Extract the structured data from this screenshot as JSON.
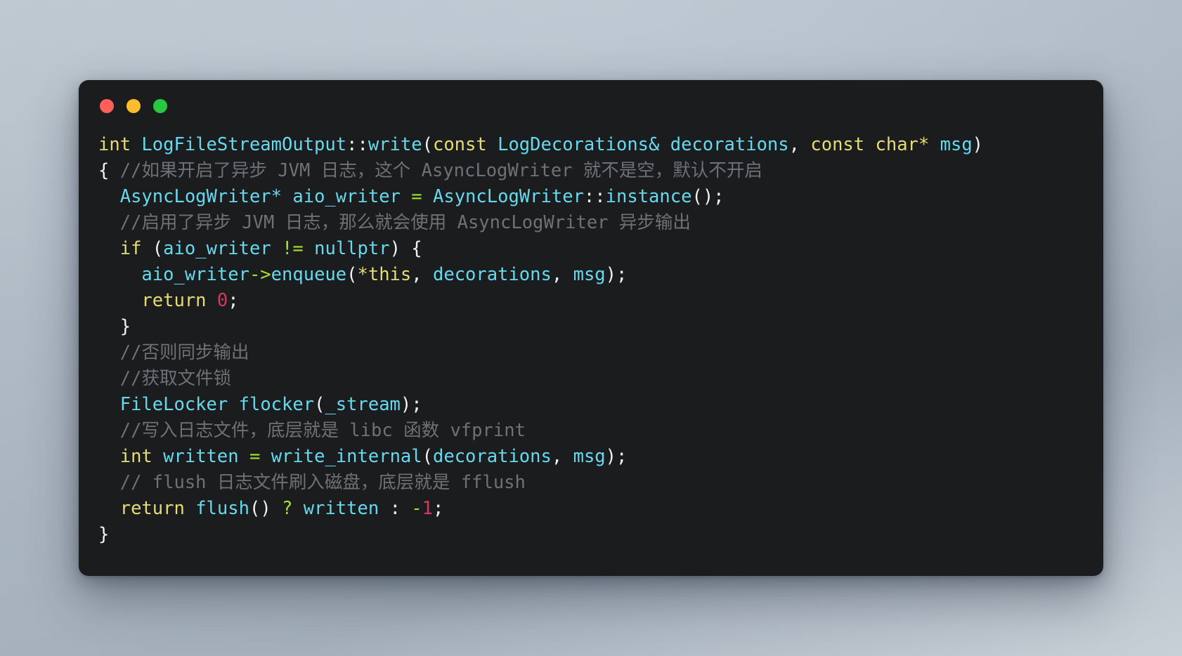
{
  "window": {
    "background_color": "#1b1c1e",
    "traffic_lights": [
      {
        "name": "close",
        "color": "#ff5f56"
      },
      {
        "name": "minimize",
        "color": "#febc2e"
      },
      {
        "name": "maximize",
        "color": "#28c840"
      }
    ]
  },
  "theme": {
    "keyword": "#e6db74",
    "type": "#66d9ef",
    "operator": "#a6e22e",
    "number": "#d7395e",
    "comment": "#6e7175",
    "punctuation": "#f2f2f2",
    "background": "#1b1c1e",
    "page_background": "#aeb9c3"
  },
  "code": {
    "language": "cpp",
    "full_text": "int LogFileStreamOutput::write(const LogDecorations& decorations, const char* msg)\n{ //如果开启了异步 JVM 日志，这个 AsyncLogWriter 就不是空，默认不开启\n  AsyncLogWriter* aio_writer = AsyncLogWriter::instance();\n  //启用了异步 JVM 日志，那么就会使用 AsyncLogWriter 异步输出\n  if (aio_writer != nullptr) {\n    aio_writer->enqueue(*this, decorations, msg);\n    return 0;\n  }\n  //否则同步输出\n  //获取文件锁\n  FileLocker flocker(_stream);\n  //写入日志文件，底层就是 libc 函数 vfprint\n  int written = write_internal(decorations, msg);\n  // flush 日志文件刷入磁盘，底层就是 fflush\n  return flush() ? written : -1;\n}",
    "lines": [
      {
        "n": 1,
        "tokens": [
          {
            "t": "int",
            "c": "kw"
          },
          {
            "t": " ",
            "c": "punct"
          },
          {
            "t": "LogFileStreamOutput",
            "c": "type"
          },
          {
            "t": "::",
            "c": "punct"
          },
          {
            "t": "write",
            "c": "type"
          },
          {
            "t": "(",
            "c": "punct"
          },
          {
            "t": "const",
            "c": "kw"
          },
          {
            "t": " ",
            "c": "punct"
          },
          {
            "t": "LogDecorations&",
            "c": "type"
          },
          {
            "t": " ",
            "c": "punct"
          },
          {
            "t": "decorations",
            "c": "type"
          },
          {
            "t": ",",
            "c": "punct"
          },
          {
            "t": " ",
            "c": "punct"
          },
          {
            "t": "const",
            "c": "kw"
          },
          {
            "t": " ",
            "c": "punct"
          },
          {
            "t": "char*",
            "c": "kw"
          },
          {
            "t": " ",
            "c": "punct"
          },
          {
            "t": "msg",
            "c": "type"
          },
          {
            "t": ")",
            "c": "punct"
          }
        ]
      },
      {
        "n": 2,
        "tokens": [
          {
            "t": "{ ",
            "c": "punct"
          },
          {
            "t": "//",
            "c": "cmt"
          },
          {
            "t": "如果开启了异步",
            "c": "cmt-cjk"
          },
          {
            "t": " JVM ",
            "c": "cmt"
          },
          {
            "t": "日志，这个",
            "c": "cmt-cjk"
          },
          {
            "t": " AsyncLogWriter ",
            "c": "cmt"
          },
          {
            "t": "就不是空，默认不开启",
            "c": "cmt-cjk"
          }
        ]
      },
      {
        "n": 3,
        "tokens": [
          {
            "t": "  ",
            "c": "punct"
          },
          {
            "t": "AsyncLogWriter*",
            "c": "type"
          },
          {
            "t": " ",
            "c": "punct"
          },
          {
            "t": "aio_writer",
            "c": "type"
          },
          {
            "t": " ",
            "c": "punct"
          },
          {
            "t": "=",
            "c": "op"
          },
          {
            "t": " ",
            "c": "punct"
          },
          {
            "t": "AsyncLogWriter",
            "c": "type"
          },
          {
            "t": "::",
            "c": "punct"
          },
          {
            "t": "instance",
            "c": "type"
          },
          {
            "t": "();",
            "c": "punct"
          }
        ]
      },
      {
        "n": 4,
        "tokens": [
          {
            "t": "  ",
            "c": "punct"
          },
          {
            "t": "//",
            "c": "cmt"
          },
          {
            "t": "启用了异步",
            "c": "cmt-cjk"
          },
          {
            "t": " JVM ",
            "c": "cmt"
          },
          {
            "t": "日志，那么就会使用",
            "c": "cmt-cjk"
          },
          {
            "t": " AsyncLogWriter ",
            "c": "cmt"
          },
          {
            "t": "异步输出",
            "c": "cmt-cjk"
          }
        ]
      },
      {
        "n": 5,
        "tokens": [
          {
            "t": "  ",
            "c": "punct"
          },
          {
            "t": "if",
            "c": "kw"
          },
          {
            "t": " (",
            "c": "punct"
          },
          {
            "t": "aio_writer",
            "c": "type"
          },
          {
            "t": " ",
            "c": "punct"
          },
          {
            "t": "!=",
            "c": "op"
          },
          {
            "t": " ",
            "c": "punct"
          },
          {
            "t": "nullptr",
            "c": "type"
          },
          {
            "t": ") {",
            "c": "punct"
          }
        ]
      },
      {
        "n": 6,
        "tokens": [
          {
            "t": "    ",
            "c": "punct"
          },
          {
            "t": "aio_writer",
            "c": "type"
          },
          {
            "t": "->",
            "c": "op"
          },
          {
            "t": "enqueue",
            "c": "type"
          },
          {
            "t": "(",
            "c": "punct"
          },
          {
            "t": "*this",
            "c": "kw"
          },
          {
            "t": ",",
            "c": "punct"
          },
          {
            "t": " ",
            "c": "punct"
          },
          {
            "t": "decorations",
            "c": "type"
          },
          {
            "t": ",",
            "c": "punct"
          },
          {
            "t": " ",
            "c": "punct"
          },
          {
            "t": "msg",
            "c": "type"
          },
          {
            "t": ");",
            "c": "punct"
          }
        ]
      },
      {
        "n": 7,
        "tokens": [
          {
            "t": "    ",
            "c": "punct"
          },
          {
            "t": "return",
            "c": "kw"
          },
          {
            "t": " ",
            "c": "punct"
          },
          {
            "t": "0",
            "c": "num"
          },
          {
            "t": ";",
            "c": "punct"
          }
        ]
      },
      {
        "n": 8,
        "tokens": [
          {
            "t": "  }",
            "c": "punct"
          }
        ]
      },
      {
        "n": 9,
        "tokens": [
          {
            "t": "  ",
            "c": "punct"
          },
          {
            "t": "//",
            "c": "cmt"
          },
          {
            "t": "否则同步输出",
            "c": "cmt-cjk"
          }
        ]
      },
      {
        "n": 10,
        "tokens": [
          {
            "t": "  ",
            "c": "punct"
          },
          {
            "t": "//",
            "c": "cmt"
          },
          {
            "t": "获取文件锁",
            "c": "cmt-cjk"
          }
        ]
      },
      {
        "n": 11,
        "tokens": [
          {
            "t": "  ",
            "c": "punct"
          },
          {
            "t": "FileLocker",
            "c": "type"
          },
          {
            "t": " ",
            "c": "punct"
          },
          {
            "t": "flocker",
            "c": "type"
          },
          {
            "t": "(",
            "c": "punct"
          },
          {
            "t": "_stream",
            "c": "type"
          },
          {
            "t": ");",
            "c": "punct"
          }
        ]
      },
      {
        "n": 12,
        "tokens": [
          {
            "t": "  ",
            "c": "punct"
          },
          {
            "t": "//",
            "c": "cmt"
          },
          {
            "t": "写入日志文件，底层就是",
            "c": "cmt-cjk"
          },
          {
            "t": " libc ",
            "c": "cmt"
          },
          {
            "t": "函数",
            "c": "cmt-cjk"
          },
          {
            "t": " vfprint",
            "c": "cmt"
          }
        ]
      },
      {
        "n": 13,
        "tokens": [
          {
            "t": "  ",
            "c": "punct"
          },
          {
            "t": "int",
            "c": "kw"
          },
          {
            "t": " ",
            "c": "punct"
          },
          {
            "t": "written",
            "c": "type"
          },
          {
            "t": " ",
            "c": "punct"
          },
          {
            "t": "=",
            "c": "op"
          },
          {
            "t": " ",
            "c": "punct"
          },
          {
            "t": "write_internal",
            "c": "type"
          },
          {
            "t": "(",
            "c": "punct"
          },
          {
            "t": "decorations",
            "c": "type"
          },
          {
            "t": ",",
            "c": "punct"
          },
          {
            "t": " ",
            "c": "punct"
          },
          {
            "t": "msg",
            "c": "type"
          },
          {
            "t": ");",
            "c": "punct"
          }
        ]
      },
      {
        "n": 14,
        "tokens": [
          {
            "t": "  ",
            "c": "punct"
          },
          {
            "t": "// flush ",
            "c": "cmt"
          },
          {
            "t": "日志文件刷入磁盘，底层就是",
            "c": "cmt-cjk"
          },
          {
            "t": " fflush",
            "c": "cmt"
          }
        ]
      },
      {
        "n": 15,
        "tokens": [
          {
            "t": "  ",
            "c": "punct"
          },
          {
            "t": "return",
            "c": "kw"
          },
          {
            "t": " ",
            "c": "punct"
          },
          {
            "t": "flush",
            "c": "type"
          },
          {
            "t": "() ",
            "c": "punct"
          },
          {
            "t": "?",
            "c": "op"
          },
          {
            "t": " ",
            "c": "punct"
          },
          {
            "t": "written",
            "c": "type"
          },
          {
            "t": " : ",
            "c": "punct"
          },
          {
            "t": "-",
            "c": "op"
          },
          {
            "t": "1",
            "c": "num"
          },
          {
            "t": ";",
            "c": "punct"
          }
        ]
      },
      {
        "n": 16,
        "tokens": [
          {
            "t": "}",
            "c": "punct"
          }
        ]
      }
    ]
  }
}
